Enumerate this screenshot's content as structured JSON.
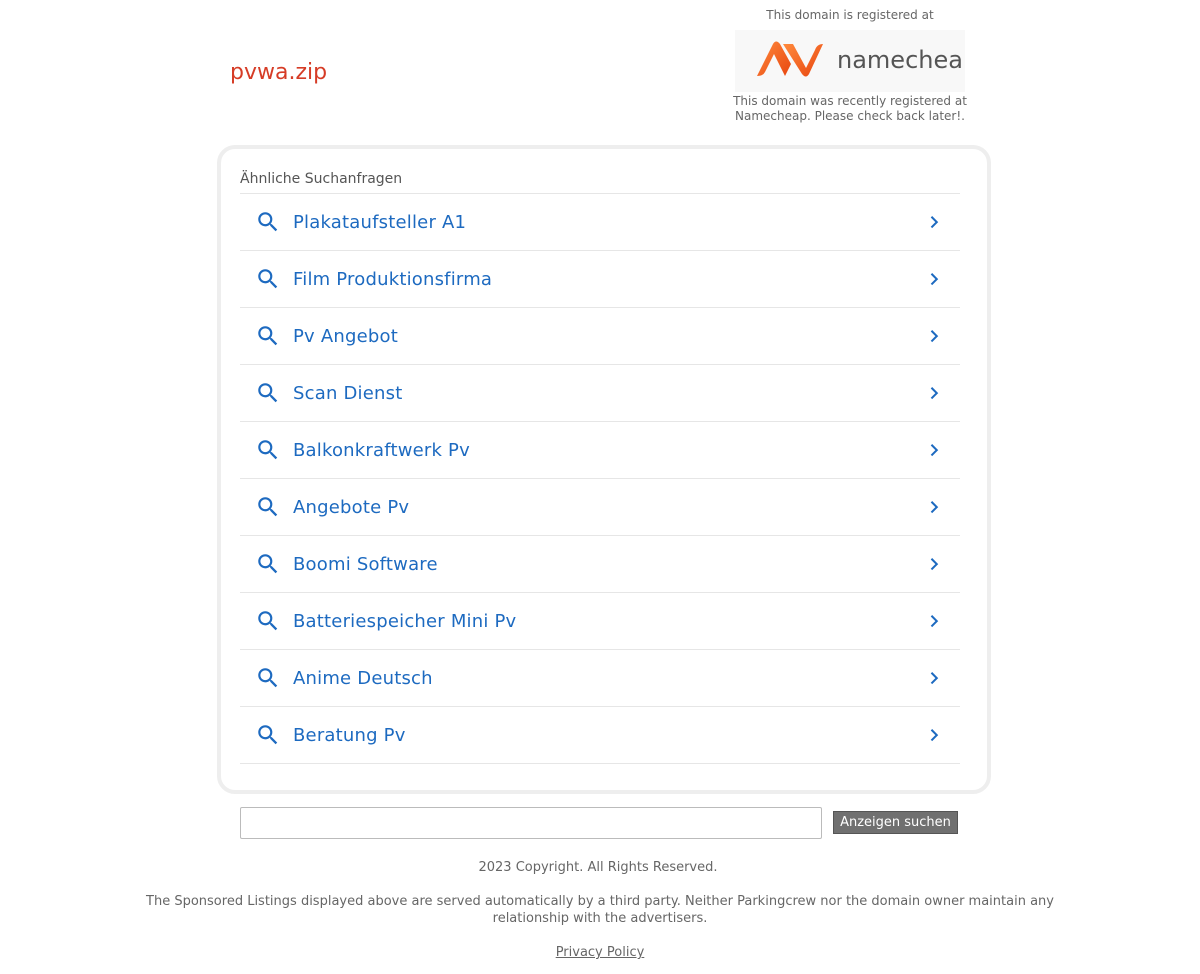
{
  "header": {
    "domain": "pvwa.zip",
    "registrar_top_note": "This domain is registered at",
    "registrar_logo_text": "namecheap",
    "registrar_bottom_note": "This domain was recently registered at Namecheap. Please check back later!."
  },
  "related": {
    "title": "Ähnliche Suchanfragen",
    "items": [
      "Plakataufsteller A1",
      "Film Produktionsfirma",
      "Pv Angebot",
      "Scan Dienst",
      "Balkonkraftwerk Pv",
      "Angebote Pv",
      "Boomi Software",
      "Batteriespeicher Mini Pv",
      "Anime Deutsch",
      "Beratung Pv"
    ]
  },
  "search": {
    "value": "",
    "button_label": "Anzeigen suchen"
  },
  "footer": {
    "copyright": "2023 Copyright. All Rights Reserved.",
    "disclaimer": "The Sponsored Listings displayed above are served automatically by a third party. Neither Parkingcrew nor the domain owner maintain any relationship with the advertisers.",
    "privacy_label": "Privacy Policy"
  },
  "colors": {
    "domain_title": "#d63c26",
    "link_blue": "#1d6ac0",
    "namecheap_orange": "#ff5d1a"
  }
}
